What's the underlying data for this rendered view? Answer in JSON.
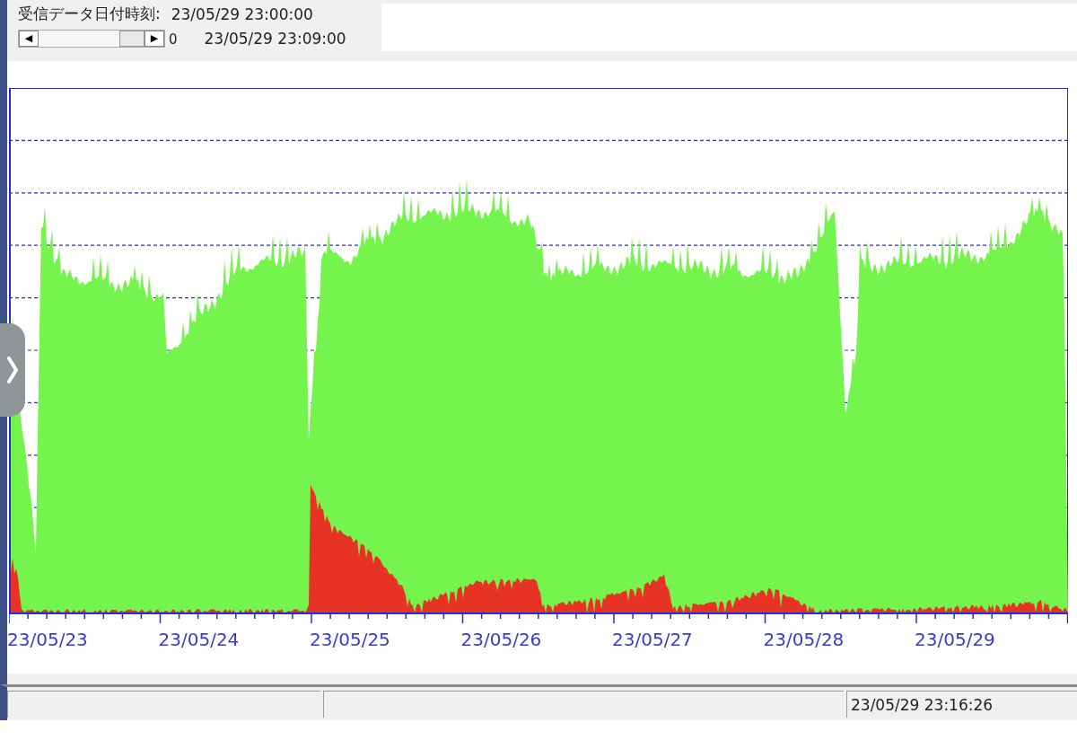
{
  "header": {
    "label": "受信データ日付時刻:",
    "start_time": "23/05/29 23:00:00",
    "end_time": "23/05/29 23:09:00",
    "scroll_left": "◀",
    "scroll_right": "▶",
    "scroll_value": "0"
  },
  "chart": {
    "x_labels": [
      "23/05/23",
      "23/05/24",
      "23/05/25",
      "23/05/26",
      "23/05/27",
      "23/05/28",
      "23/05/29"
    ]
  },
  "status_bar": {
    "time": "23/05/29 23:16:26"
  }
}
